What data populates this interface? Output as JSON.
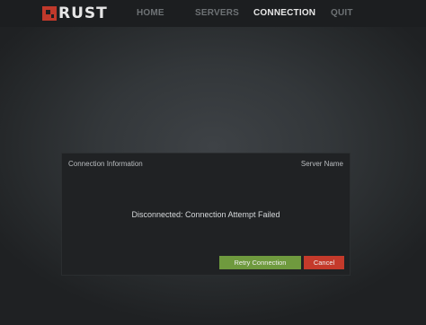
{
  "logo": {
    "text": "RUST",
    "icon": "rust-logo-icon",
    "color": "#c0392b"
  },
  "nav": {
    "items": [
      {
        "label": "HOME",
        "active": false
      },
      {
        "label": "SERVERS",
        "active": false
      },
      {
        "label": "CONNECTION",
        "active": true
      },
      {
        "label": "QUIT",
        "active": false
      }
    ]
  },
  "dialog": {
    "title": "Connection Information",
    "server_name": "Server Name",
    "message": "Disconnected: Connection Attempt Failed",
    "retry_label": "Retry Connection",
    "cancel_label": "Cancel"
  },
  "colors": {
    "retry": "#6f9a3e",
    "cancel": "#c43a2b",
    "active_nav": "#e8e8e8",
    "inactive_nav": "#6e7275"
  }
}
